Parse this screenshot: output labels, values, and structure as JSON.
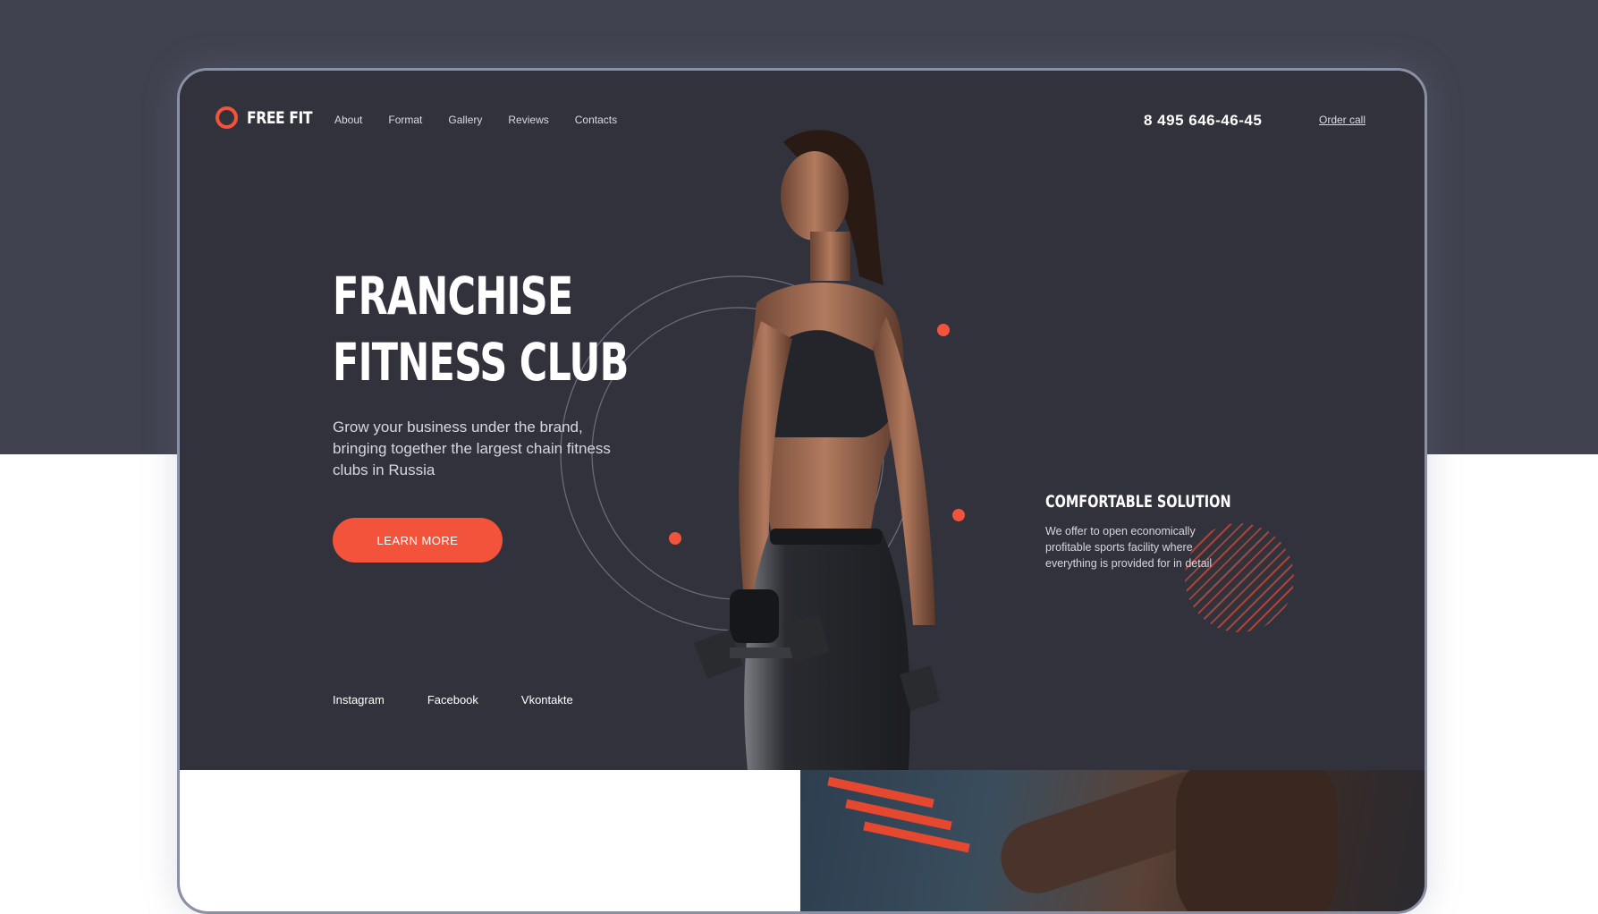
{
  "brand": {
    "name": "FREE FIT"
  },
  "nav": {
    "items": [
      {
        "label": "About"
      },
      {
        "label": "Format"
      },
      {
        "label": "Gallery"
      },
      {
        "label": "Reviews"
      },
      {
        "label": "Contacts"
      }
    ]
  },
  "header": {
    "phone": "8 495 646-46-45",
    "order_call": "Order call"
  },
  "hero": {
    "title_line1": "FRANCHISE",
    "title_line2": "FITNESS CLUB",
    "subtitle": "Grow your business under the brand, bringing together the largest chain fitness clubs in Russia",
    "cta": "LEARN MORE"
  },
  "socials": [
    {
      "label": "Instagram"
    },
    {
      "label": "Facebook"
    },
    {
      "label": "Vkontakte"
    }
  ],
  "solution": {
    "title": "COMFORTABLE SOLUTION",
    "text": "We offer to open economically profitable sports facility where everything is provided for in detail"
  },
  "colors": {
    "accent": "#f2533a",
    "page_bg_dark": "#40424f",
    "hero_bg": "#31323b",
    "frame_border": "#8a91a6"
  },
  "icons": {
    "logo": "ring-logo-icon"
  }
}
